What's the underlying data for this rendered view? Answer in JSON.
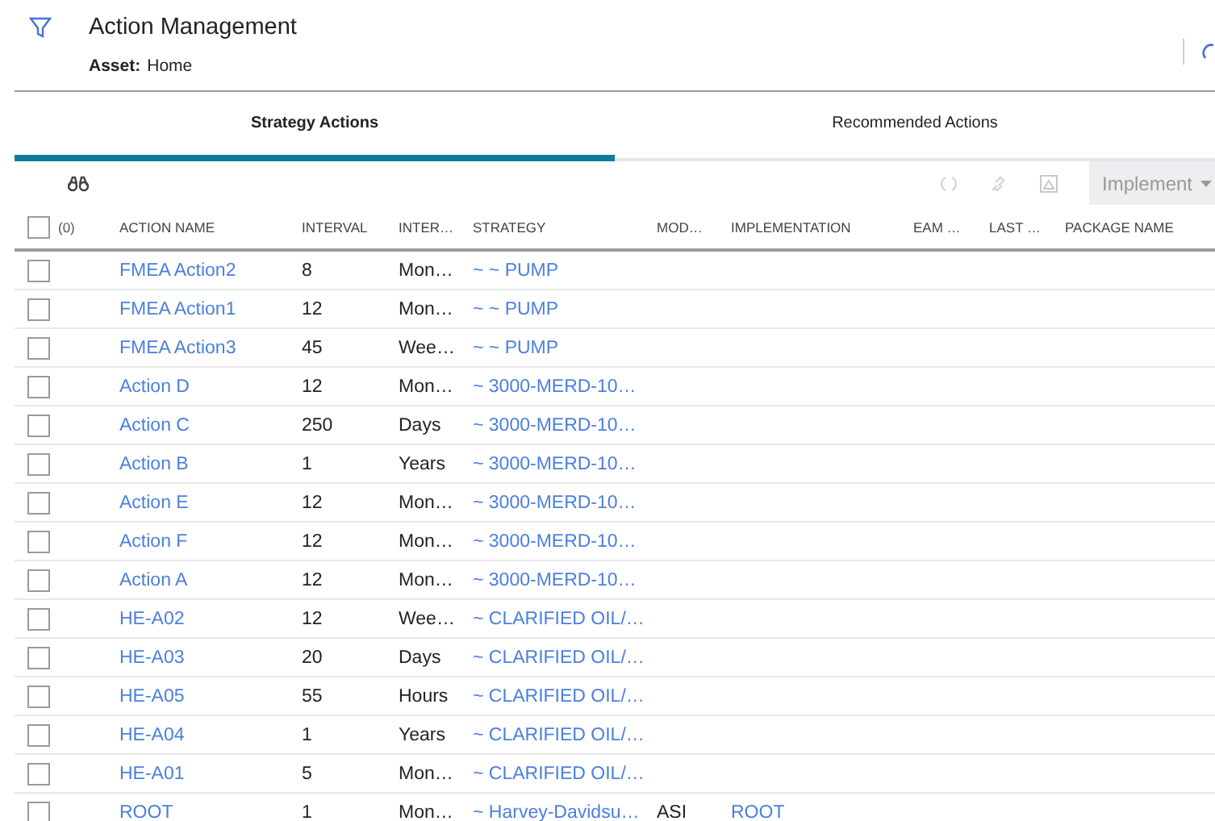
{
  "header": {
    "title": "Action Management",
    "asset_label": "Asset:",
    "asset_value": "Home"
  },
  "tabs": [
    {
      "label": "Strategy Actions",
      "selected": true
    },
    {
      "label": "Recommended Actions",
      "selected": false
    }
  ],
  "toolbar": {
    "implement_button": "Implement",
    "refresh_disabled": true,
    "link_disabled": true,
    "image_disabled": true
  },
  "table": {
    "select_all_checked": false,
    "selected_count": "(0)",
    "columns": [
      "ACTION NAME",
      "INTERVAL",
      "INTER…",
      "STRATEGY",
      "MOD…",
      "IMPLEMENTATION",
      "EAM …",
      "LAST …",
      "PACKAGE NAME"
    ],
    "rows": [
      {
        "checked": false,
        "name": "FMEA Action2",
        "interval": "8",
        "unit": "Mon…",
        "strategy": "~ ~ PUMP"
      },
      {
        "checked": false,
        "name": "FMEA Action1",
        "interval": "12",
        "unit": "Mon…",
        "strategy": "~ ~ PUMP"
      },
      {
        "checked": false,
        "name": "FMEA Action3",
        "interval": "45",
        "unit": "Wee…",
        "strategy": "~ ~ PUMP"
      },
      {
        "checked": false,
        "name": "Action D",
        "interval": "12",
        "unit": "Mon…",
        "strategy": "~ 3000-MERD-10…"
      },
      {
        "checked": false,
        "name": "Action C",
        "interval": "250",
        "unit": "Days",
        "strategy": "~ 3000-MERD-10…"
      },
      {
        "checked": false,
        "name": "Action B",
        "interval": "1",
        "unit": "Years",
        "strategy": "~ 3000-MERD-10…"
      },
      {
        "checked": false,
        "name": "Action E",
        "interval": "12",
        "unit": "Mon…",
        "strategy": "~ 3000-MERD-10…"
      },
      {
        "checked": false,
        "name": "Action F",
        "interval": "12",
        "unit": "Mon…",
        "strategy": "~ 3000-MERD-10…"
      },
      {
        "checked": false,
        "name": "Action A",
        "interval": "12",
        "unit": "Mon…",
        "strategy": "~ 3000-MERD-10…"
      },
      {
        "checked": false,
        "name": "HE-A02",
        "interval": "12",
        "unit": "Wee…",
        "strategy": "~ CLARIFIED OIL/…"
      },
      {
        "checked": false,
        "name": "HE-A03",
        "interval": "20",
        "unit": "Days",
        "strategy": "~ CLARIFIED OIL/…"
      },
      {
        "checked": false,
        "name": "HE-A05",
        "interval": "55",
        "unit": "Hours",
        "strategy": "~ CLARIFIED OIL/…"
      },
      {
        "checked": false,
        "name": "HE-A04",
        "interval": "1",
        "unit": "Years",
        "strategy": "~ CLARIFIED OIL/…"
      },
      {
        "checked": false,
        "name": "HE-A01",
        "interval": "5",
        "unit": "Mon…",
        "strategy": "~ CLARIFIED OIL/…"
      },
      {
        "checked": false,
        "name": "ROOT",
        "interval": "1",
        "unit": "Mon…",
        "strategy": "~ Harvey-Davidsu…",
        "mod": "ASI",
        "implementation": "ROOT"
      }
    ]
  }
}
